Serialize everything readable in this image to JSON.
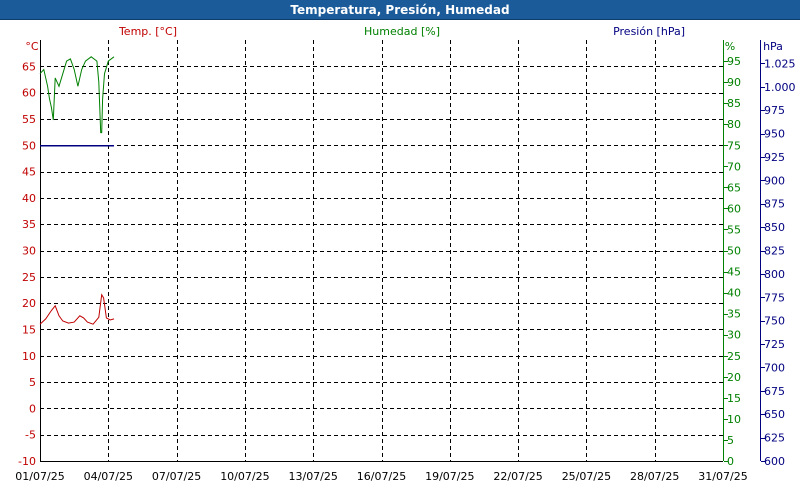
{
  "window": {
    "title": "Temperatura, Presión, Humedad"
  },
  "colors": {
    "temp": "#c00000",
    "hum": "#008000",
    "pres": "#000080"
  },
  "chart_data": {
    "type": "line",
    "series_labels": {
      "temp": "Temp. [°C]",
      "hum": "Humedad [%]",
      "pres": "Presión [hPa]"
    },
    "axes": {
      "temp": {
        "unit": "°C",
        "min": -10,
        "max": 70,
        "step": 5,
        "ticks": [
          "65",
          "60",
          "55",
          "50",
          "45",
          "40",
          "35",
          "30",
          "25",
          "20",
          "15",
          "10",
          "5",
          "0",
          "-5",
          "-10"
        ]
      },
      "hum": {
        "unit": "%",
        "min": 0,
        "max": 100,
        "step": 5,
        "ticks": [
          "95",
          "90",
          "85",
          "80",
          "75",
          "70",
          "65",
          "60",
          "55",
          "50",
          "45",
          "40",
          "35",
          "30",
          "25",
          "20",
          "15",
          "10",
          "5",
          "0"
        ]
      },
      "pres": {
        "unit": "hPa",
        "min": 600,
        "max": 1050,
        "ticks": [
          "1.025",
          "1.000",
          "975",
          "950",
          "925",
          "900",
          "875",
          "850",
          "825",
          "800",
          "775",
          "750",
          "725",
          "700",
          "675",
          "650",
          "625",
          "600"
        ]
      }
    },
    "x_axis": {
      "start": "2025-07-01",
      "end": "2025-07-31",
      "ticks": [
        "01/07/25",
        "04/07/25",
        "07/07/25",
        "10/07/25",
        "13/07/25",
        "16/07/25",
        "19/07/25",
        "22/07/25",
        "25/07/25",
        "28/07/25",
        "31/07/25"
      ]
    },
    "grid": true,
    "series": [
      {
        "key": "temp",
        "points": [
          [
            "2025-07-01T00:00",
            16
          ],
          [
            "2025-07-01T06:00",
            17
          ],
          [
            "2025-07-01T12:00",
            18.6
          ],
          [
            "2025-07-01T16:00",
            19.5
          ],
          [
            "2025-07-01T20:00",
            17.6
          ],
          [
            "2025-07-02T00:00",
            16.6
          ],
          [
            "2025-07-02T06:00",
            16.2
          ],
          [
            "2025-07-02T12:00",
            16.4
          ],
          [
            "2025-07-02T18:00",
            17.6
          ],
          [
            "2025-07-02T22:00",
            17.2
          ],
          [
            "2025-07-03T02:00",
            16.4
          ],
          [
            "2025-07-03T08:00",
            16
          ],
          [
            "2025-07-03T14:00",
            17.3
          ],
          [
            "2025-07-03T17:00",
            21.6
          ],
          [
            "2025-07-03T19:00",
            21
          ],
          [
            "2025-07-03T22:00",
            17.2
          ],
          [
            "2025-07-04T02:00",
            16.8
          ],
          [
            "2025-07-04T06:00",
            17
          ]
        ]
      },
      {
        "key": "hum",
        "points": [
          [
            "2025-07-01T00:00",
            92
          ],
          [
            "2025-07-01T04:00",
            93
          ],
          [
            "2025-07-01T08:00",
            89
          ],
          [
            "2025-07-01T10:00",
            86
          ],
          [
            "2025-07-01T12:00",
            84
          ],
          [
            "2025-07-01T14:00",
            81
          ],
          [
            "2025-07-01T16:00",
            91
          ],
          [
            "2025-07-01T20:00",
            89
          ],
          [
            "2025-07-02T00:00",
            92
          ],
          [
            "2025-07-02T04:00",
            95
          ],
          [
            "2025-07-02T08:00",
            95.5
          ],
          [
            "2025-07-02T12:00",
            93
          ],
          [
            "2025-07-02T16:00",
            89
          ],
          [
            "2025-07-02T20:00",
            93
          ],
          [
            "2025-07-03T00:00",
            95
          ],
          [
            "2025-07-03T06:00",
            96
          ],
          [
            "2025-07-03T12:00",
            95
          ],
          [
            "2025-07-03T14:00",
            90
          ],
          [
            "2025-07-03T16:00",
            78
          ],
          [
            "2025-07-03T17:00",
            78
          ],
          [
            "2025-07-03T18:00",
            86
          ],
          [
            "2025-07-03T20:00",
            92
          ],
          [
            "2025-07-04T00:00",
            95
          ],
          [
            "2025-07-04T06:00",
            96
          ]
        ]
      },
      {
        "key": "pres",
        "points": [
          [
            "2025-07-01T00:00",
            937
          ],
          [
            "2025-07-02T00:00",
            937
          ],
          [
            "2025-07-03T00:00",
            937
          ],
          [
            "2025-07-04T06:00",
            937
          ]
        ]
      }
    ]
  }
}
